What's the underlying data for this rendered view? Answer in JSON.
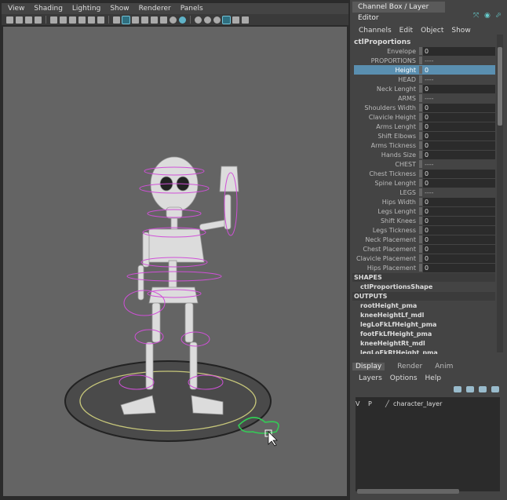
{
  "viewport": {
    "menu": [
      "View",
      "Shading",
      "Lighting",
      "Show",
      "Renderer",
      "Panels"
    ]
  },
  "channel_box": {
    "tab_label": "Channel Box / Layer Editor",
    "menu": [
      "Channels",
      "Edit",
      "Object",
      "Show"
    ],
    "object_name": "ctlProportions",
    "attributes": [
      {
        "label": "Envelope",
        "value": "0"
      },
      {
        "label": "PROPORTIONS",
        "value": "----"
      },
      {
        "label": "Height",
        "value": "0"
      },
      {
        "label": "HEAD",
        "value": "----"
      },
      {
        "label": "Neck Lenght",
        "value": "0"
      },
      {
        "label": "ARMS",
        "value": "----"
      },
      {
        "label": "Shoulders Width",
        "value": "0"
      },
      {
        "label": "Clavicle Height",
        "value": "0"
      },
      {
        "label": "Arms Lenght",
        "value": "0"
      },
      {
        "label": "Shift Elbows",
        "value": "0"
      },
      {
        "label": "Arms Tickness",
        "value": "0"
      },
      {
        "label": "Hands Size",
        "value": "0"
      },
      {
        "label": "CHEST",
        "value": "----"
      },
      {
        "label": "Chest Tickness",
        "value": "0"
      },
      {
        "label": "Spine Lenght",
        "value": "0"
      },
      {
        "label": "LEGS",
        "value": "----"
      },
      {
        "label": "Hips Width",
        "value": "0"
      },
      {
        "label": "Legs Lenght",
        "value": "0"
      },
      {
        "label": "Shift Knees",
        "value": "0"
      },
      {
        "label": "Legs Tickness",
        "value": "0"
      },
      {
        "label": "Neck Placement",
        "value": "0"
      },
      {
        "label": "Chest Placement",
        "value": "0"
      },
      {
        "label": "Clavicle Placement",
        "value": "0"
      },
      {
        "label": "Hips Placement",
        "value": "0"
      }
    ],
    "shapes_label": "SHAPES",
    "shape_node": "ctlProportionsShape",
    "outputs_label": "OUTPUTS",
    "output_nodes": [
      "rootHeight_pma",
      "kneeHeightLf_mdl",
      "legLoFkLfHeight_pma",
      "footFkLfHeight_pma",
      "kneeHeightRt_mdl",
      "legLoFkRtHeight_pma"
    ]
  },
  "layer_editor": {
    "tabs": [
      "Display",
      "Render",
      "Anim"
    ],
    "menu": [
      "Layers",
      "Options",
      "Help"
    ],
    "layer": {
      "v": "V",
      "p": "P",
      "name": "character_layer"
    }
  }
}
